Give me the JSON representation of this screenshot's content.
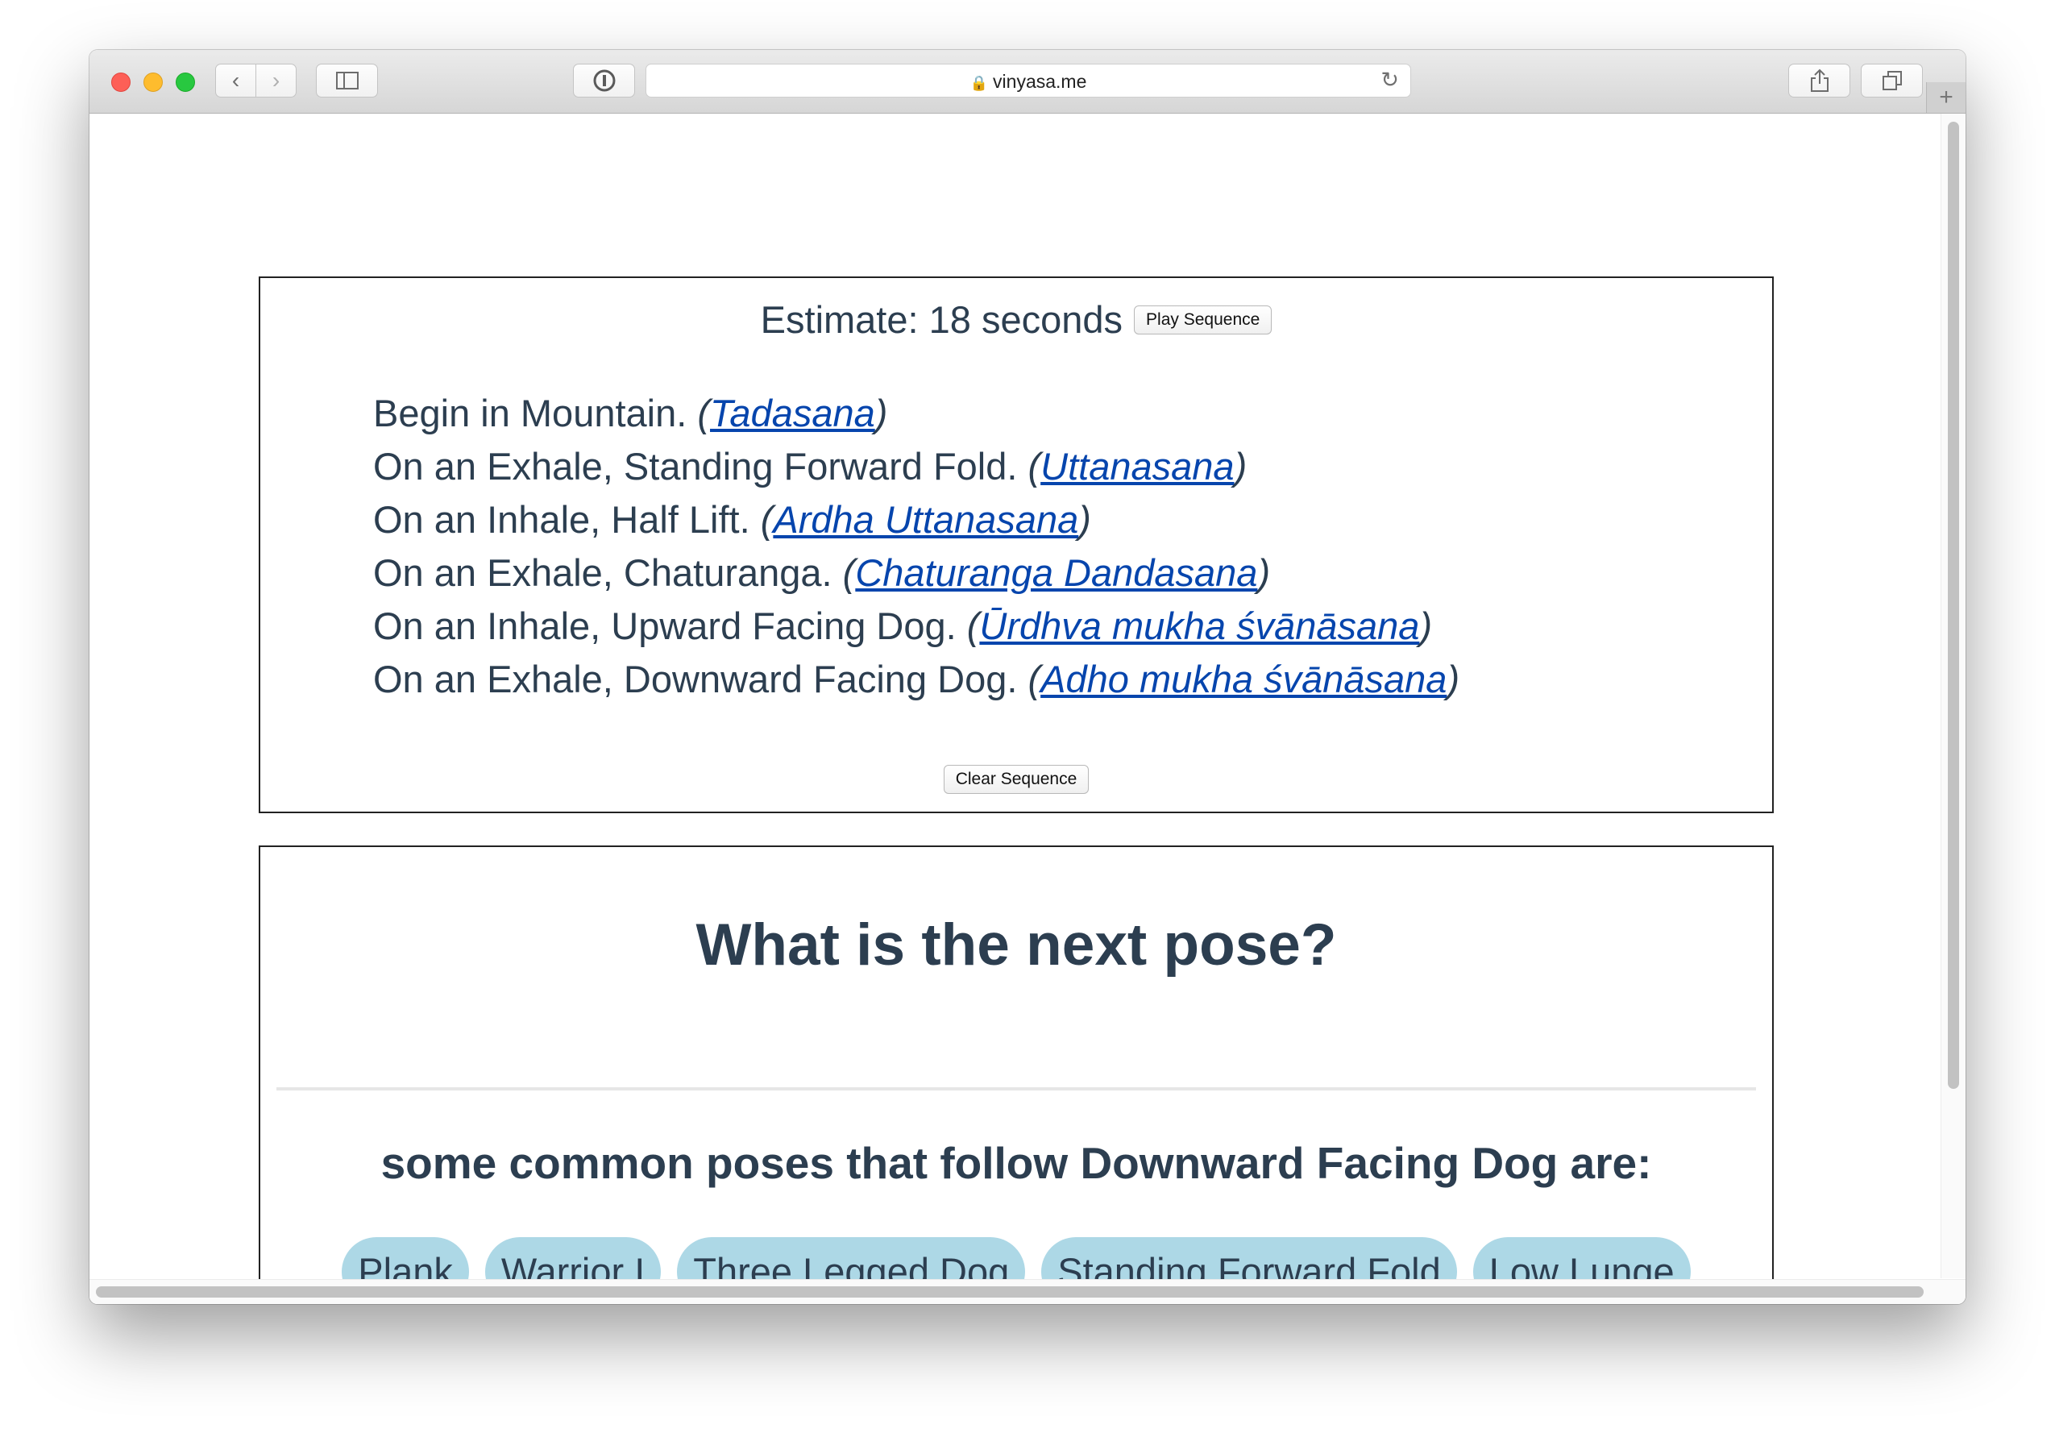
{
  "browser": {
    "url": "vinyasa.me"
  },
  "sequence": {
    "estimate": "Estimate: 18 seconds",
    "play_label": "Play Sequence",
    "clear_label": "Clear Sequence",
    "steps": [
      {
        "text": "Begin in Mountain. ",
        "sanskrit": "Tadasana"
      },
      {
        "text": "On an Exhale, Standing Forward Fold. ",
        "sanskrit": "Uttanasana"
      },
      {
        "text": "On an Inhale, Half Lift. ",
        "sanskrit": "Ardha Uttanasana"
      },
      {
        "text": "On an Exhale, Chaturanga. ",
        "sanskrit": "Chaturanga Dandasana"
      },
      {
        "text": "On an Inhale, Upward Facing Dog. ",
        "sanskrit": "Ūrdhva mukha śvānāsana"
      },
      {
        "text": "On an Exhale, Downward Facing Dog. ",
        "sanskrit": "Adho mukha śvānāsana"
      }
    ]
  },
  "next": {
    "question": "What is the next pose?",
    "common_heading": "some common poses that follow Downward Facing Dog are:",
    "poses": [
      "Plank",
      "Warrior I",
      "Three Legged Dog",
      "Standing Forward Fold",
      "Low Lunge"
    ]
  }
}
